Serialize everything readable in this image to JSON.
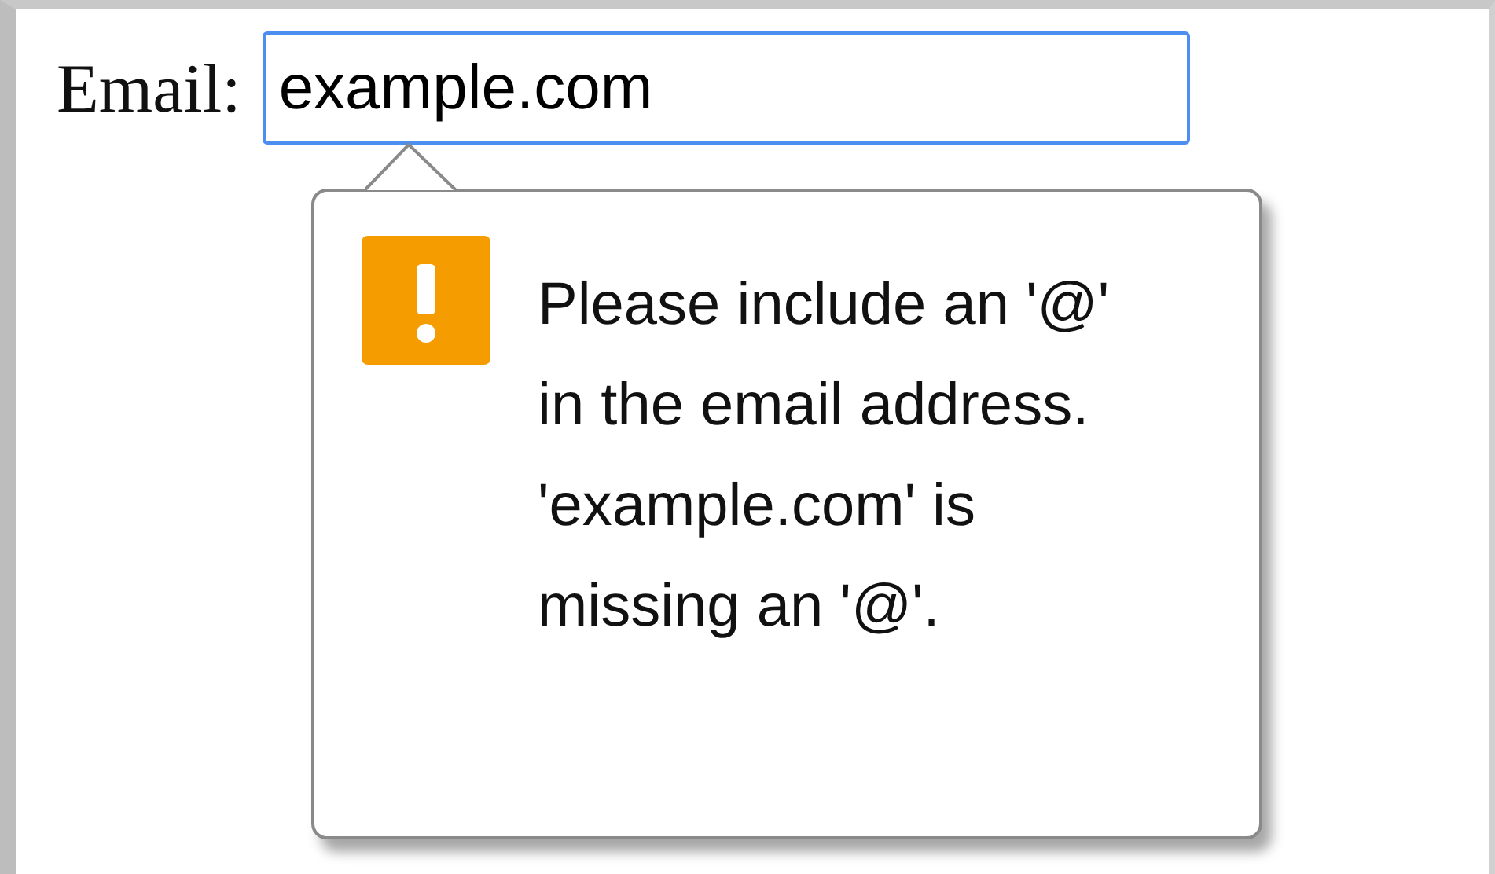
{
  "field": {
    "label": "Email:",
    "value": "example.com",
    "focused": true
  },
  "tooltip": {
    "message": "Please include an '@' in the email address. 'example.com' is missing an '@'."
  }
}
